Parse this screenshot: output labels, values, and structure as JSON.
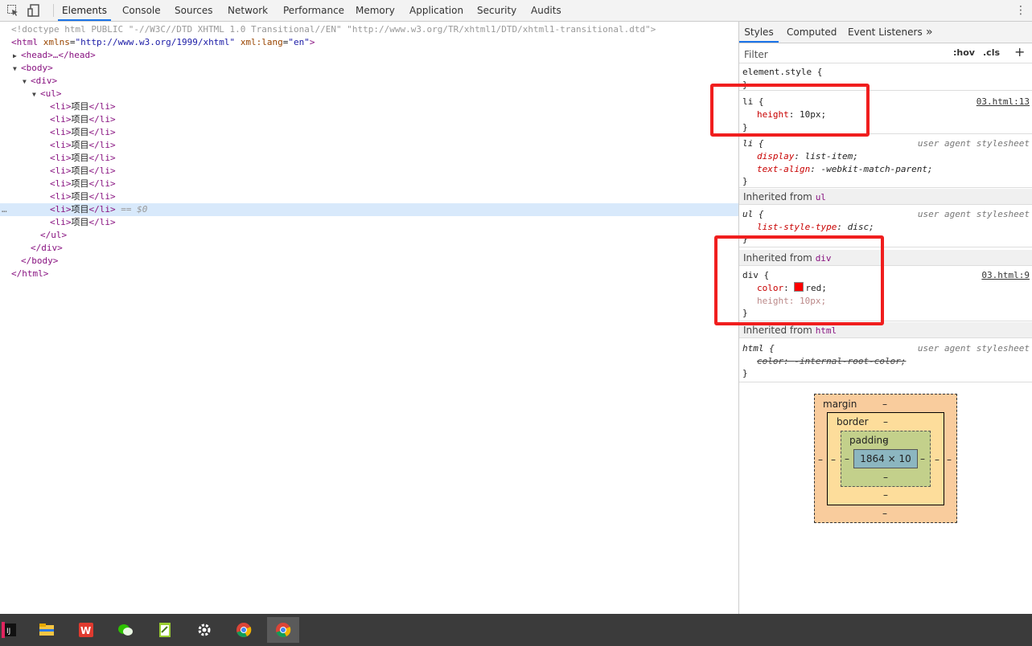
{
  "toolbar": {
    "tabs": [
      "Elements",
      "Console",
      "Sources",
      "Network",
      "Performance",
      "Memory",
      "Application",
      "Security",
      "Audits"
    ],
    "active_tab": "Elements",
    "inspect_icon": "inspect-cursor-icon",
    "device_icon": "device-toggle-icon",
    "menu_icon": "kebab-menu-icon"
  },
  "dom": {
    "doctype": "<!doctype html PUBLIC \"-//W3C//DTD XHTML 1.0 Transitional//EN\" \"http://www.w3.org/TR/xhtml1/DTD/xhtml1-transitional.dtd\">",
    "html_open": {
      "tag": "<html",
      "attr1": "xmlns",
      "val1": "\"http://www.w3.org/1999/xhtml\"",
      "attr2": "xml:lang",
      "val2": "\"en\"",
      "close": ">"
    },
    "head": "<head>…</head>",
    "body_open": "<body>",
    "div_open": "<div>",
    "ul_open": "<ul>",
    "li_open": "<li>",
    "li_text": "项目",
    "li_close": "</li>",
    "li_count": 10,
    "selected_marker": "== $0",
    "ellipsis": "…",
    "ul_close": "</ul>",
    "div_close": "</div>",
    "body_close": "</body>",
    "html_close": "</html>"
  },
  "styles": {
    "tabs": [
      "Styles",
      "Computed",
      "Event Listeners"
    ],
    "more": "»",
    "filter_placeholder": "Filter",
    "hov": ":hov",
    "cls": ".cls",
    "add": "+",
    "element_style": "element.style {",
    "close_brace": "}",
    "rule_li": {
      "selector": "li {",
      "prop": "height",
      "value": "10px;",
      "source": "03.html:13"
    },
    "rule_li_ua": {
      "selector": "li {",
      "source": "user agent stylesheet",
      "p1": "display",
      "v1": "list-item;",
      "p2": "text-align",
      "v2": "-webkit-match-parent;"
    },
    "inherited_label": "Inherited from",
    "inh_ul": "ul",
    "rule_ul": {
      "selector": "ul {",
      "source": "user agent stylesheet",
      "prop": "list-style-type",
      "value": "disc;"
    },
    "inh_div": "div",
    "rule_div": {
      "selector": "div {",
      "source": "03.html:9",
      "p1": "color",
      "v1": "red;",
      "p2": "height",
      "v2": "10px;"
    },
    "inh_html": "html",
    "rule_html": {
      "selector": "html {",
      "source": "user agent stylesheet",
      "prop": "color",
      "value": "-internal-root-color;"
    },
    "colors": {
      "swatch": "#ff0000",
      "annotation": "#f01e1e"
    }
  },
  "box_model": {
    "margin": "margin",
    "border": "border",
    "padding": "padding",
    "dash": "–",
    "content": "1864 × 10"
  },
  "taskbar": {
    "apps": [
      "intellij-icon",
      "file-explorer-icon",
      "wps-icon",
      "wechat-icon",
      "notepad-icon",
      "settings-gear-icon",
      "chrome-icon",
      "chrome-active-icon"
    ]
  }
}
